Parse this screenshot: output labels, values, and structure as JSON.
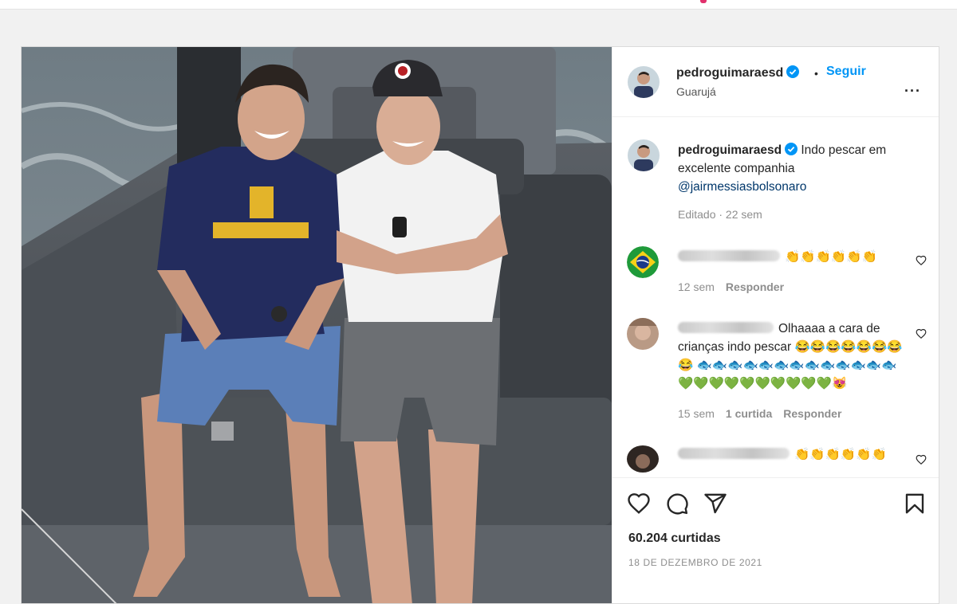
{
  "post": {
    "username": "pedroguimaraesd",
    "follow_label": "Seguir",
    "separator": "•",
    "location": "Guarujá",
    "more_label": "...",
    "caption": {
      "username": "pedroguimaraesd",
      "text": "Indo pescar em excelente companhia",
      "mention": "@jairmessiasbolsonaro",
      "meta": "Editado · 22 sem"
    },
    "comments": [
      {
        "text": "👏👏👏👏👏👏",
        "time": "12 sem",
        "likes": "",
        "reply": "Responder"
      },
      {
        "text": "Olhaaaa a cara de crianças indo pescar 😂😂😂😂😂😂😂😂 🐟🐟🐟🐟🐟🐟🐟🐟🐟🐟🐟🐟🐟💚💚💚💚💚💚💚💚💚💚😻",
        "time": "15 sem",
        "likes": "1 curtida",
        "reply": "Responder"
      },
      {
        "text": "👏👏👏👏👏👏",
        "time": "",
        "likes": "",
        "reply": ""
      }
    ],
    "likes": "60.204 curtidas",
    "date": "18 DE DEZEMBRO DE 2021"
  },
  "colors": {
    "accent": "#0095f6",
    "verified": "#0095f6",
    "muted": "#8e8e8e",
    "mention": "#00376b"
  },
  "icons": [
    "verified-icon",
    "heart-icon",
    "comment-icon",
    "share-icon",
    "bookmark-icon",
    "more-icon"
  ]
}
